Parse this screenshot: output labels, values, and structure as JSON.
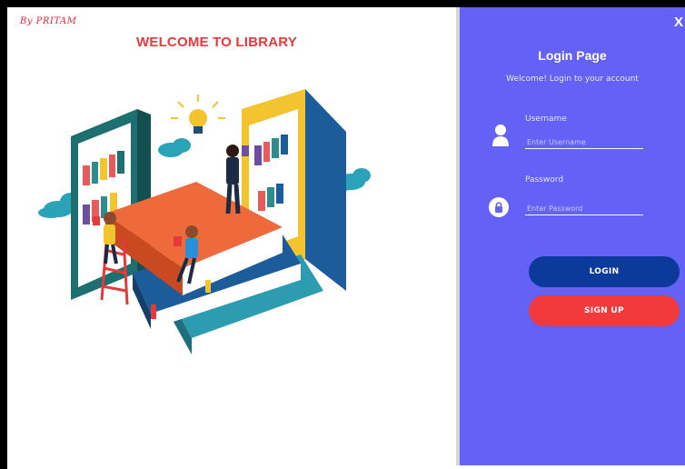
{
  "left": {
    "author": "By PRITAM",
    "welcome": "WELCOME TO LIBRARY"
  },
  "right": {
    "close": "X",
    "title": "Login Page",
    "subtitle": "Welcome! Login to your account",
    "username": {
      "label": "Username",
      "placeholder": "Enter Username"
    },
    "password": {
      "label": "Password",
      "placeholder": "Enter Password"
    },
    "login_label": "LOGIN",
    "signup_label": "SIGN UP"
  },
  "colors": {
    "panel": "#6461f7",
    "login_button": "#0b3a9a",
    "signup_button": "#f23a3c",
    "heading": "#e53a3a"
  },
  "icons": [
    "user-icon",
    "lock-icon",
    "lightbulb-icon"
  ]
}
